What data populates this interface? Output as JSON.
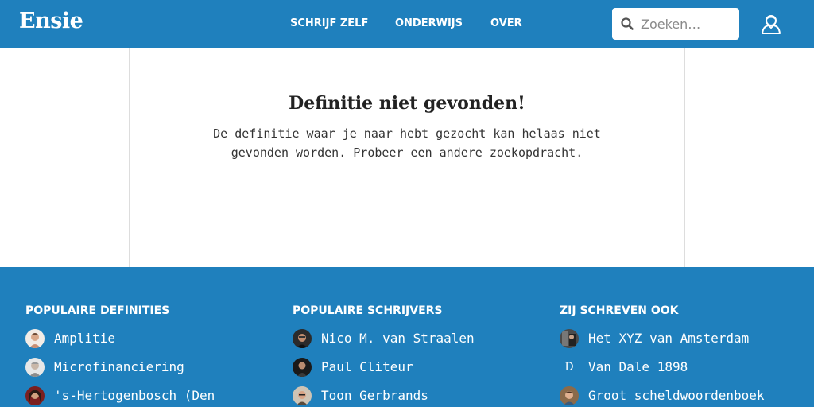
{
  "header": {
    "logo": "Ensie",
    "nav": [
      "SCHRIJF ZELF",
      "ONDERWIJS",
      "OVER"
    ],
    "search_placeholder": "Zoeken…",
    "icons": {
      "search": "search-icon",
      "account": "user-icon"
    }
  },
  "main": {
    "title": "Definitie niet gevonden!",
    "message": "De definitie waar je naar hebt gezocht kan helaas niet gevonden worden. Probeer een andere zoekopdracht."
  },
  "footer": {
    "columns": [
      {
        "title": "POPULAIRE DEFINITIES",
        "items": [
          "Amplitie",
          "Microfinanciering",
          "'s-Hertogenbosch (Den"
        ]
      },
      {
        "title": "POPULAIRE SCHRIJVERS",
        "items": [
          "Nico M. van Straalen",
          "Paul Cliteur",
          "Toon Gerbrands"
        ]
      },
      {
        "title": "ZIJ SCHREVEN OOK",
        "items": [
          "Het XYZ van Amsterdam",
          "Van Dale 1898",
          "Groot scheldwoordenboek"
        ]
      }
    ],
    "van_dale_badge": "D"
  },
  "colors": {
    "brand_blue": "#1f80bd",
    "panel_border": "#dddddd",
    "text_dark": "#222222"
  }
}
